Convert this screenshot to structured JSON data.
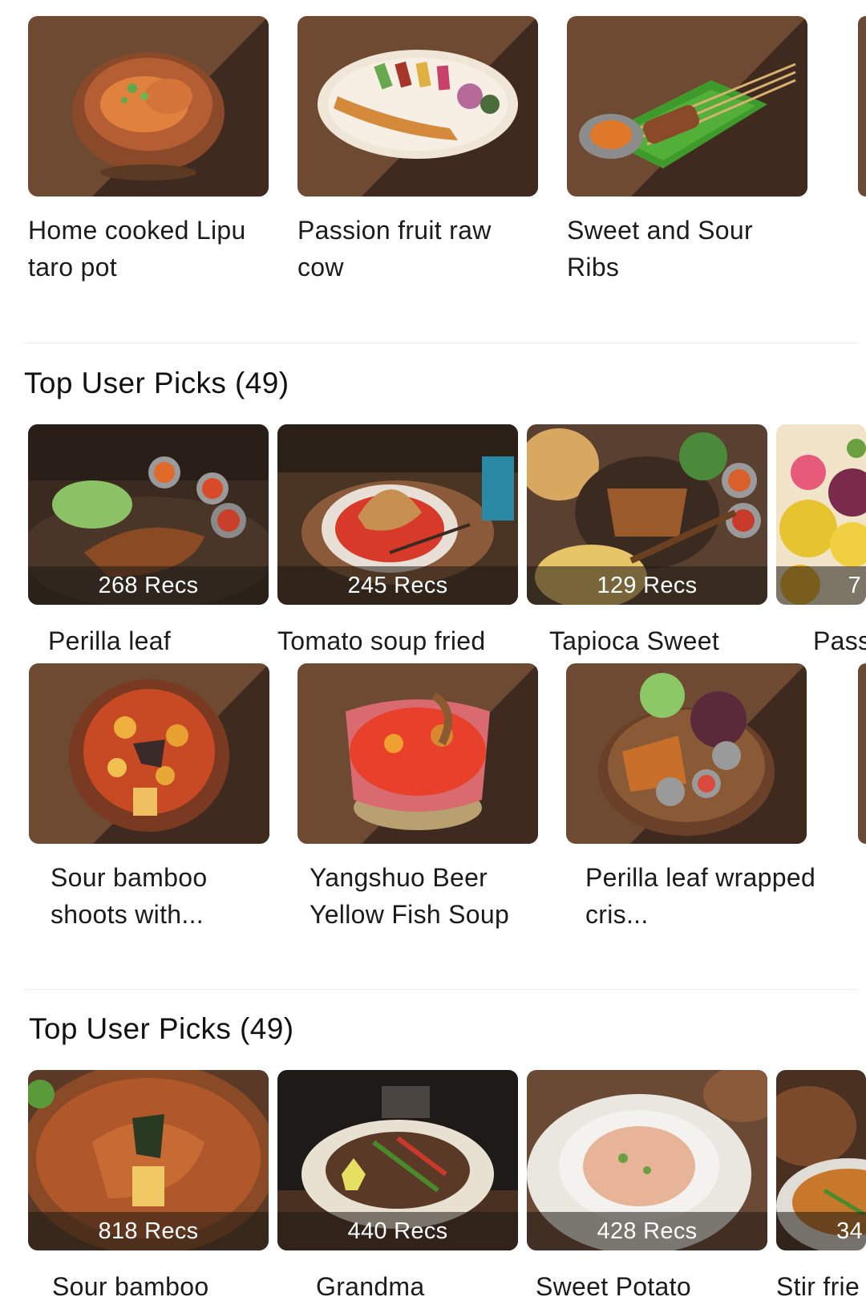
{
  "top_row": [
    {
      "name": "Home cooked Lipu taro pot",
      "icon": "taro-pot-dish-image"
    },
    {
      "name": "Passion fruit raw cow",
      "icon": "raw-beef-platter-image"
    },
    {
      "name": "Sweet and Sour Ribs",
      "icon": "skewer-ribs-image"
    }
  ],
  "section1": {
    "title": "Top User Picks (49)",
    "picks": [
      {
        "recs": "268 Recs",
        "name": "Perilla leaf"
      },
      {
        "recs": "245 Recs",
        "name": "Tomato soup fried"
      },
      {
        "recs": "129 Recs",
        "name": "Tapioca Sweet"
      },
      {
        "recs": "7",
        "name": "Pass"
      }
    ],
    "dishes": [
      {
        "name": "Sour bamboo shoots with..."
      },
      {
        "name": "Yangshuo Beer Yellow Fish Soup"
      },
      {
        "name": "Perilla leaf wrapped cris..."
      }
    ]
  },
  "section2": {
    "title": "Top User Picks (49)",
    "picks": [
      {
        "recs": "818 Recs",
        "name": "Sour bamboo"
      },
      {
        "recs": "440 Recs",
        "name": "Grandma"
      },
      {
        "recs": "428 Recs",
        "name": "Sweet Potato"
      },
      {
        "recs": "34",
        "name": "Stir frie"
      }
    ]
  },
  "colors": {
    "text": "#1b1b1b",
    "divider": "#ededed",
    "studio_bg": "#5a3e2c",
    "overlay": "rgba(30,25,20,0.55)"
  }
}
